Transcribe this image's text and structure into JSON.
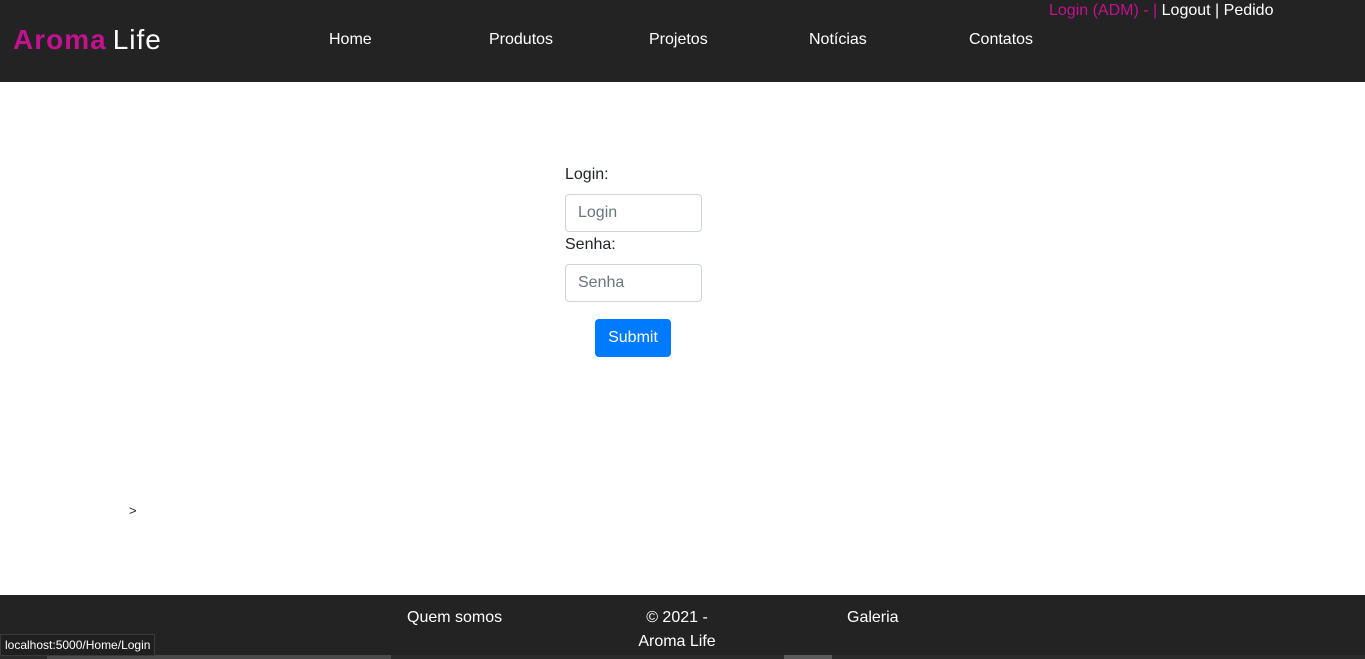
{
  "brand": {
    "name_part1": "Aroma",
    "name_part2": "Life",
    "accent_color": "#c2128f"
  },
  "nav": {
    "items": [
      {
        "label": "Home"
      },
      {
        "label": "Produtos"
      },
      {
        "label": "Projetos"
      },
      {
        "label": "Notícias"
      },
      {
        "label": "Contatos"
      }
    ]
  },
  "userbar": {
    "login_label": "Login (ADM)",
    "sep_dash": " - ",
    "sep_pipe": "|",
    "logout_label": "Logout",
    "sep_pipe2": "|",
    "order_label": "Pedido"
  },
  "login_form": {
    "login_label": "Login:",
    "login_placeholder": "Login",
    "password_label": "Senha:",
    "password_placeholder": "Senha",
    "submit_label": "Submit",
    "submit_color": "#007bff"
  },
  "stray_text": ">",
  "footer": {
    "about_label": "Quem somos",
    "copyright_line1": "© 2021 -",
    "copyright_line2": "Aroma Life",
    "gallery_label": "Galeria"
  },
  "status_bar": {
    "url": "localhost:5000/Home/Login"
  }
}
